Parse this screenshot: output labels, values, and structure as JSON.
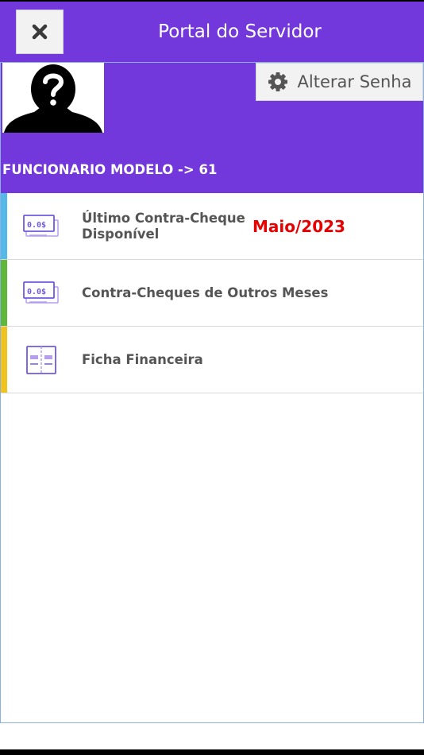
{
  "header": {
    "title": "Portal do Servidor",
    "close_icon": "close-icon"
  },
  "profile": {
    "avatar_icon": "unknown-person-icon",
    "change_password_label": "Alterar Senha",
    "employee": "FUNCIONARIO MODELO -> 61"
  },
  "menu": {
    "items": [
      {
        "label": "Último Contra-Cheque Disponível",
        "date": "Maio/2023",
        "icon": "payslip-icon",
        "accent": "#55b8e6"
      },
      {
        "label": "Contra-Cheques de Outros Meses",
        "icon": "payslip-icon",
        "accent": "#5fb83a"
      },
      {
        "label": "Ficha Financeira",
        "icon": "financial-sheet-icon",
        "accent": "#f0c31e"
      }
    ]
  },
  "colors": {
    "brand": "#7338dc",
    "date_text": "#e60000"
  }
}
